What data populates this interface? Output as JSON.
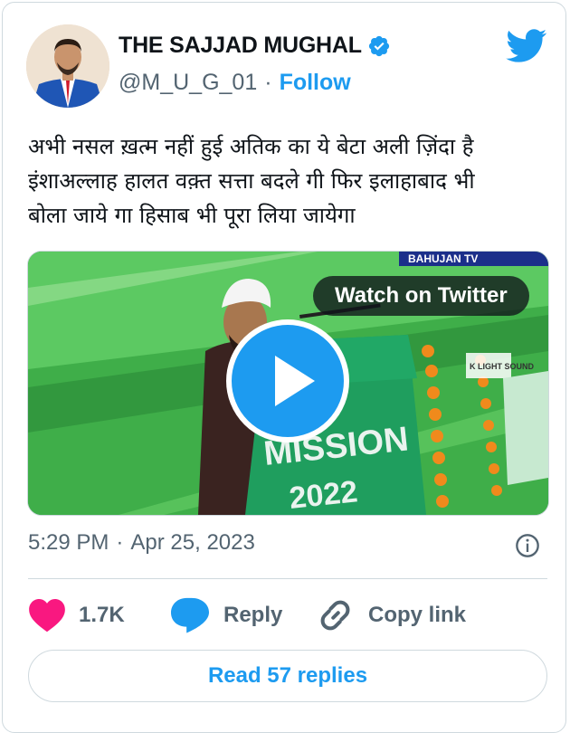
{
  "author": {
    "name": "THE SAJJAD MUGHAL",
    "handle": "@M_U_G_01",
    "separator": "·",
    "follow_label": "Follow",
    "verified": true
  },
  "tweet": {
    "text_lines": [
      "अभी नसल ख़त्म नहीं हुई अतिक का ये बेटा अली ज़िंदा है",
      "इंशाअल्लाह हालत वक़्त सत्ता बदले गी फिर इलाहाबाद भी",
      "बोला जाये गा हिसाब भी पूरा लिया जायेगा"
    ],
    "time": "5:29 PM",
    "separator": "·",
    "date": "Apr 25, 2023"
  },
  "media": {
    "watch_label": "Watch on Twitter",
    "banner_text": "MISSION",
    "banner_year": "2022",
    "channel_text": "BAHUJAN TV",
    "sound_text": "K LIGHT SOUND"
  },
  "actions": {
    "likes": "1.7K",
    "reply_label": "Reply",
    "copy_label": "Copy link",
    "read_replies": "Read 57 replies"
  },
  "colors": {
    "accent": "#1d9bf0",
    "like": "#f91880",
    "muted": "#536471"
  }
}
